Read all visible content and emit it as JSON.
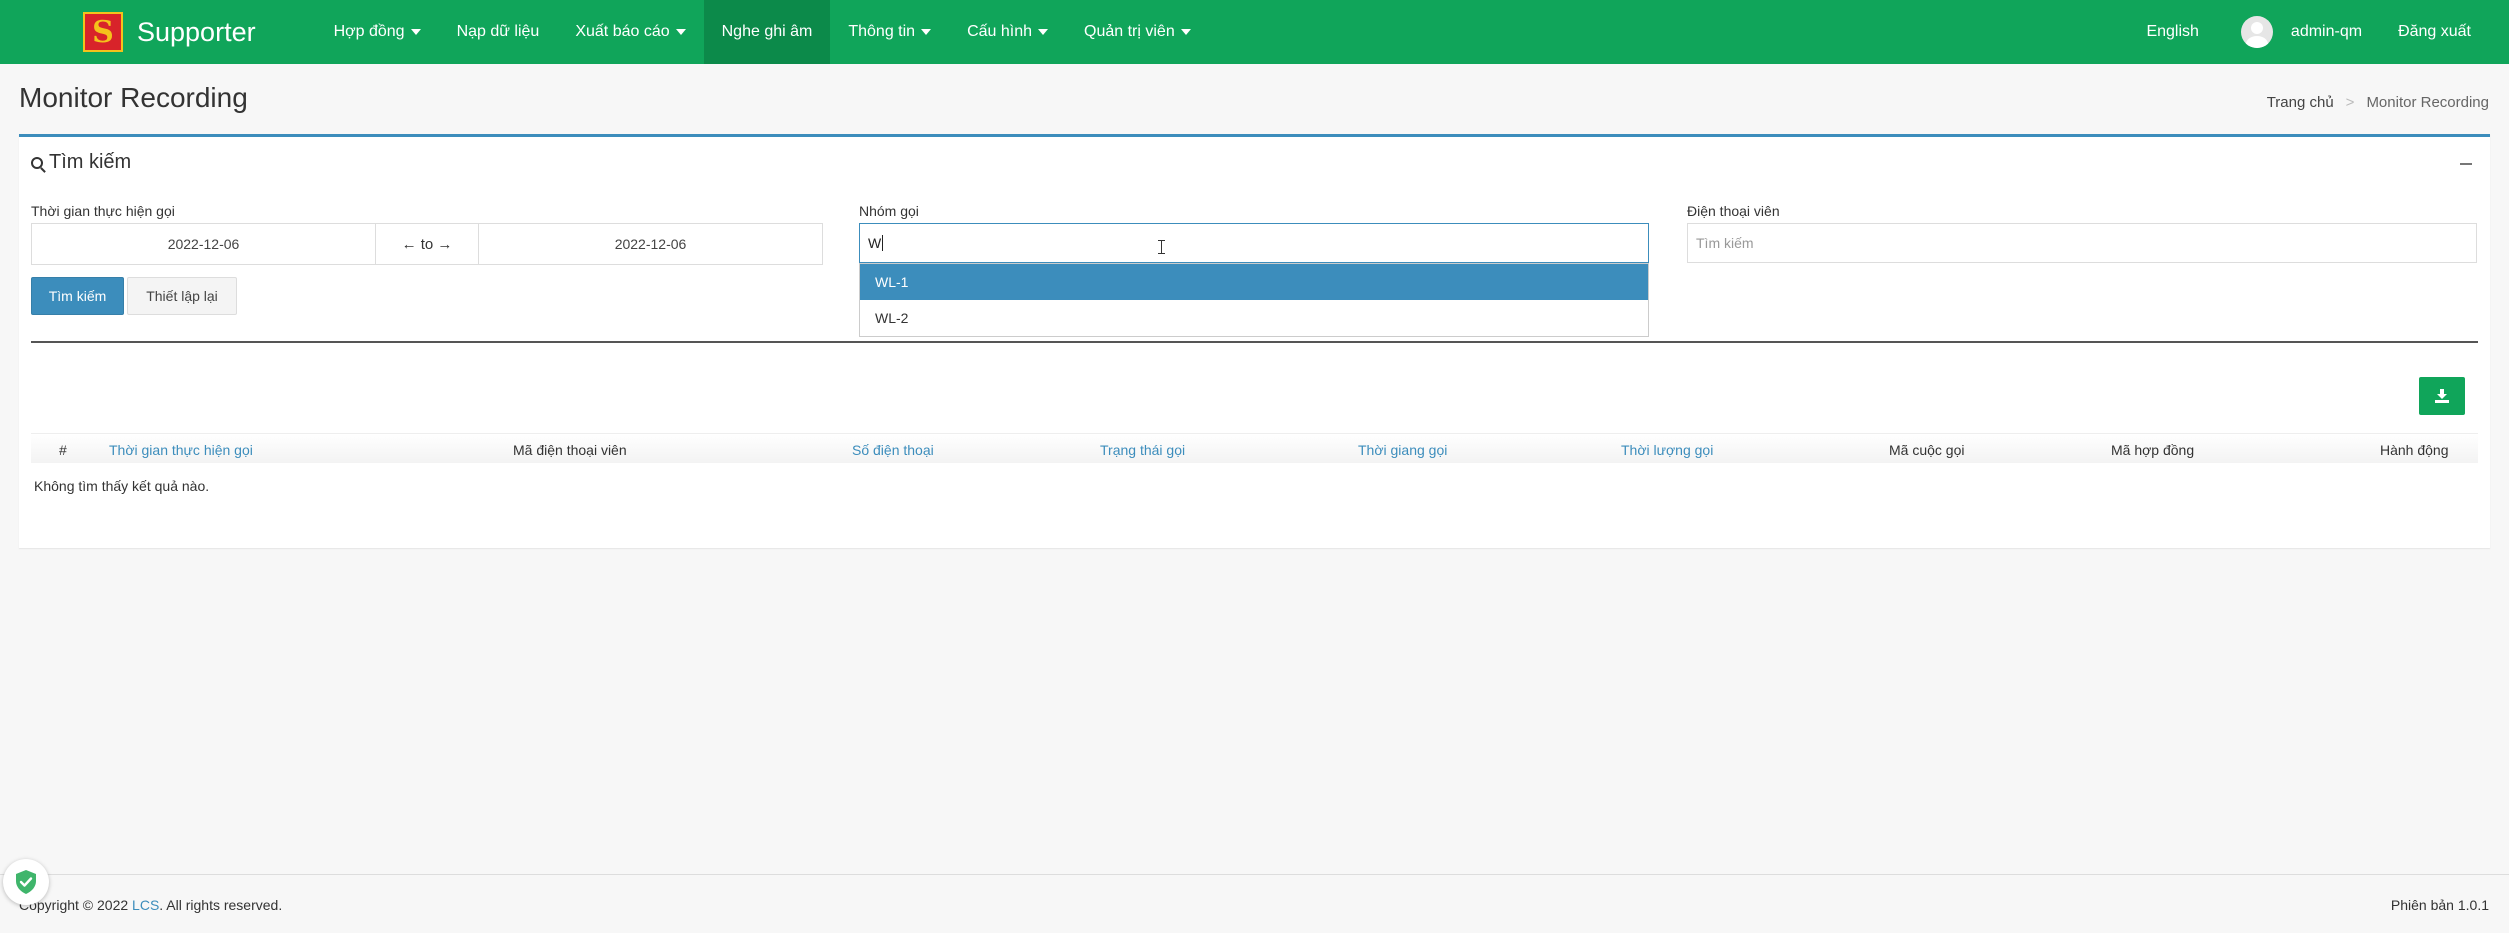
{
  "navbar": {
    "brand": "Supporter",
    "logo_letter": "S",
    "menu": [
      {
        "label": "Hợp đồng",
        "dropdown": true
      },
      {
        "label": "Nạp dữ liệu",
        "dropdown": false
      },
      {
        "label": "Xuất báo cáo",
        "dropdown": true
      },
      {
        "label": "Nghe ghi âm",
        "dropdown": false,
        "active": true
      },
      {
        "label": "Thông tin",
        "dropdown": true
      },
      {
        "label": "Cấu hình",
        "dropdown": true
      },
      {
        "label": "Quản trị viên",
        "dropdown": true
      }
    ],
    "language": "English",
    "username": "admin-qm",
    "logout": "Đăng xuất"
  },
  "page": {
    "title": "Monitor Recording",
    "breadcrumb": {
      "home": "Trang chủ",
      "sep": ">",
      "current": "Monitor Recording"
    }
  },
  "search": {
    "title": "Tìm kiếm",
    "date_label": "Thời gian thực hiện gọi",
    "date_from": "2022-12-06",
    "date_sep": "← to →",
    "date_to": "2022-12-06",
    "group_label": "Nhóm gọi",
    "group_value": "W",
    "group_options": [
      "WL-1",
      "WL-2"
    ],
    "agent_label": "Điện thoại viên",
    "agent_placeholder": "Tìm kiếm",
    "search_button": "Tìm kiếm",
    "reset_button": "Thiết lập lại"
  },
  "table": {
    "headers": [
      {
        "label": "#",
        "sortable": false
      },
      {
        "label": "Thời gian thực hiện gọi",
        "sortable": true
      },
      {
        "label": "Mã điện thoại viên",
        "sortable": false
      },
      {
        "label": "Số điện thoại",
        "sortable": true
      },
      {
        "label": "Trạng thái gọi",
        "sortable": true
      },
      {
        "label": "Thời giang gọi",
        "sortable": true
      },
      {
        "label": "Thời lượng gọi",
        "sortable": true
      },
      {
        "label": "Mã cuộc gọi",
        "sortable": false
      },
      {
        "label": "Mã hợp đồng",
        "sortable": false
      },
      {
        "label": "Hành động",
        "sortable": false
      }
    ],
    "empty_message": "Không tìm thấy kết quả nào."
  },
  "footer": {
    "copyright_prefix": "Copyright © 2022 ",
    "company": "LCS",
    "copyright_suffix": ". All rights reserved.",
    "version": "Phiên bản 1.0.1"
  },
  "colors": {
    "nav_bg": "#10a55a",
    "primary": "#3c8dbc",
    "success": "#10a55a"
  }
}
